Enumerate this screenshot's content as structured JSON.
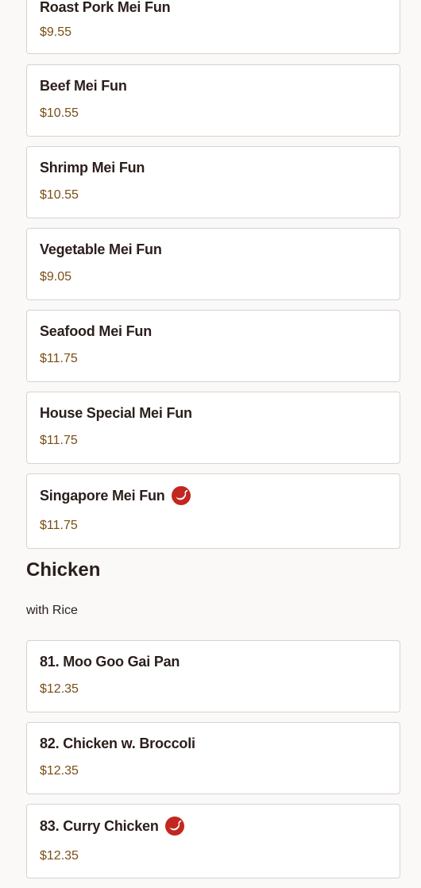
{
  "mei_fun": {
    "items": [
      {
        "name": "Roast Pork Mei Fun",
        "price": "$9.55",
        "spicy": false
      },
      {
        "name": "Beef Mei Fun",
        "price": "$10.55",
        "spicy": false
      },
      {
        "name": "Shrimp Mei Fun",
        "price": "$10.55",
        "spicy": false
      },
      {
        "name": "Vegetable Mei Fun",
        "price": "$9.05",
        "spicy": false
      },
      {
        "name": "Seafood Mei Fun",
        "price": "$11.75",
        "spicy": false
      },
      {
        "name": "House Special Mei Fun",
        "price": "$11.75",
        "spicy": false
      },
      {
        "name": "Singapore Mei Fun",
        "price": "$11.75",
        "spicy": true
      }
    ]
  },
  "chicken": {
    "title": "Chicken",
    "subtitle": "with Rice",
    "items": [
      {
        "name": "81. Moo Goo Gai Pan",
        "price": "$12.35",
        "spicy": false
      },
      {
        "name": "82. Chicken w. Broccoli",
        "price": "$12.35",
        "spicy": false
      },
      {
        "name": "83. Curry Chicken",
        "price": "$12.35",
        "spicy": true
      }
    ]
  },
  "icons": {
    "spicy": "chili-pepper-icon"
  },
  "colors": {
    "price": "#7a4e14",
    "spicy_badge": "#c2271f",
    "card_border": "#d6d3d0",
    "background": "#faf9f8"
  }
}
